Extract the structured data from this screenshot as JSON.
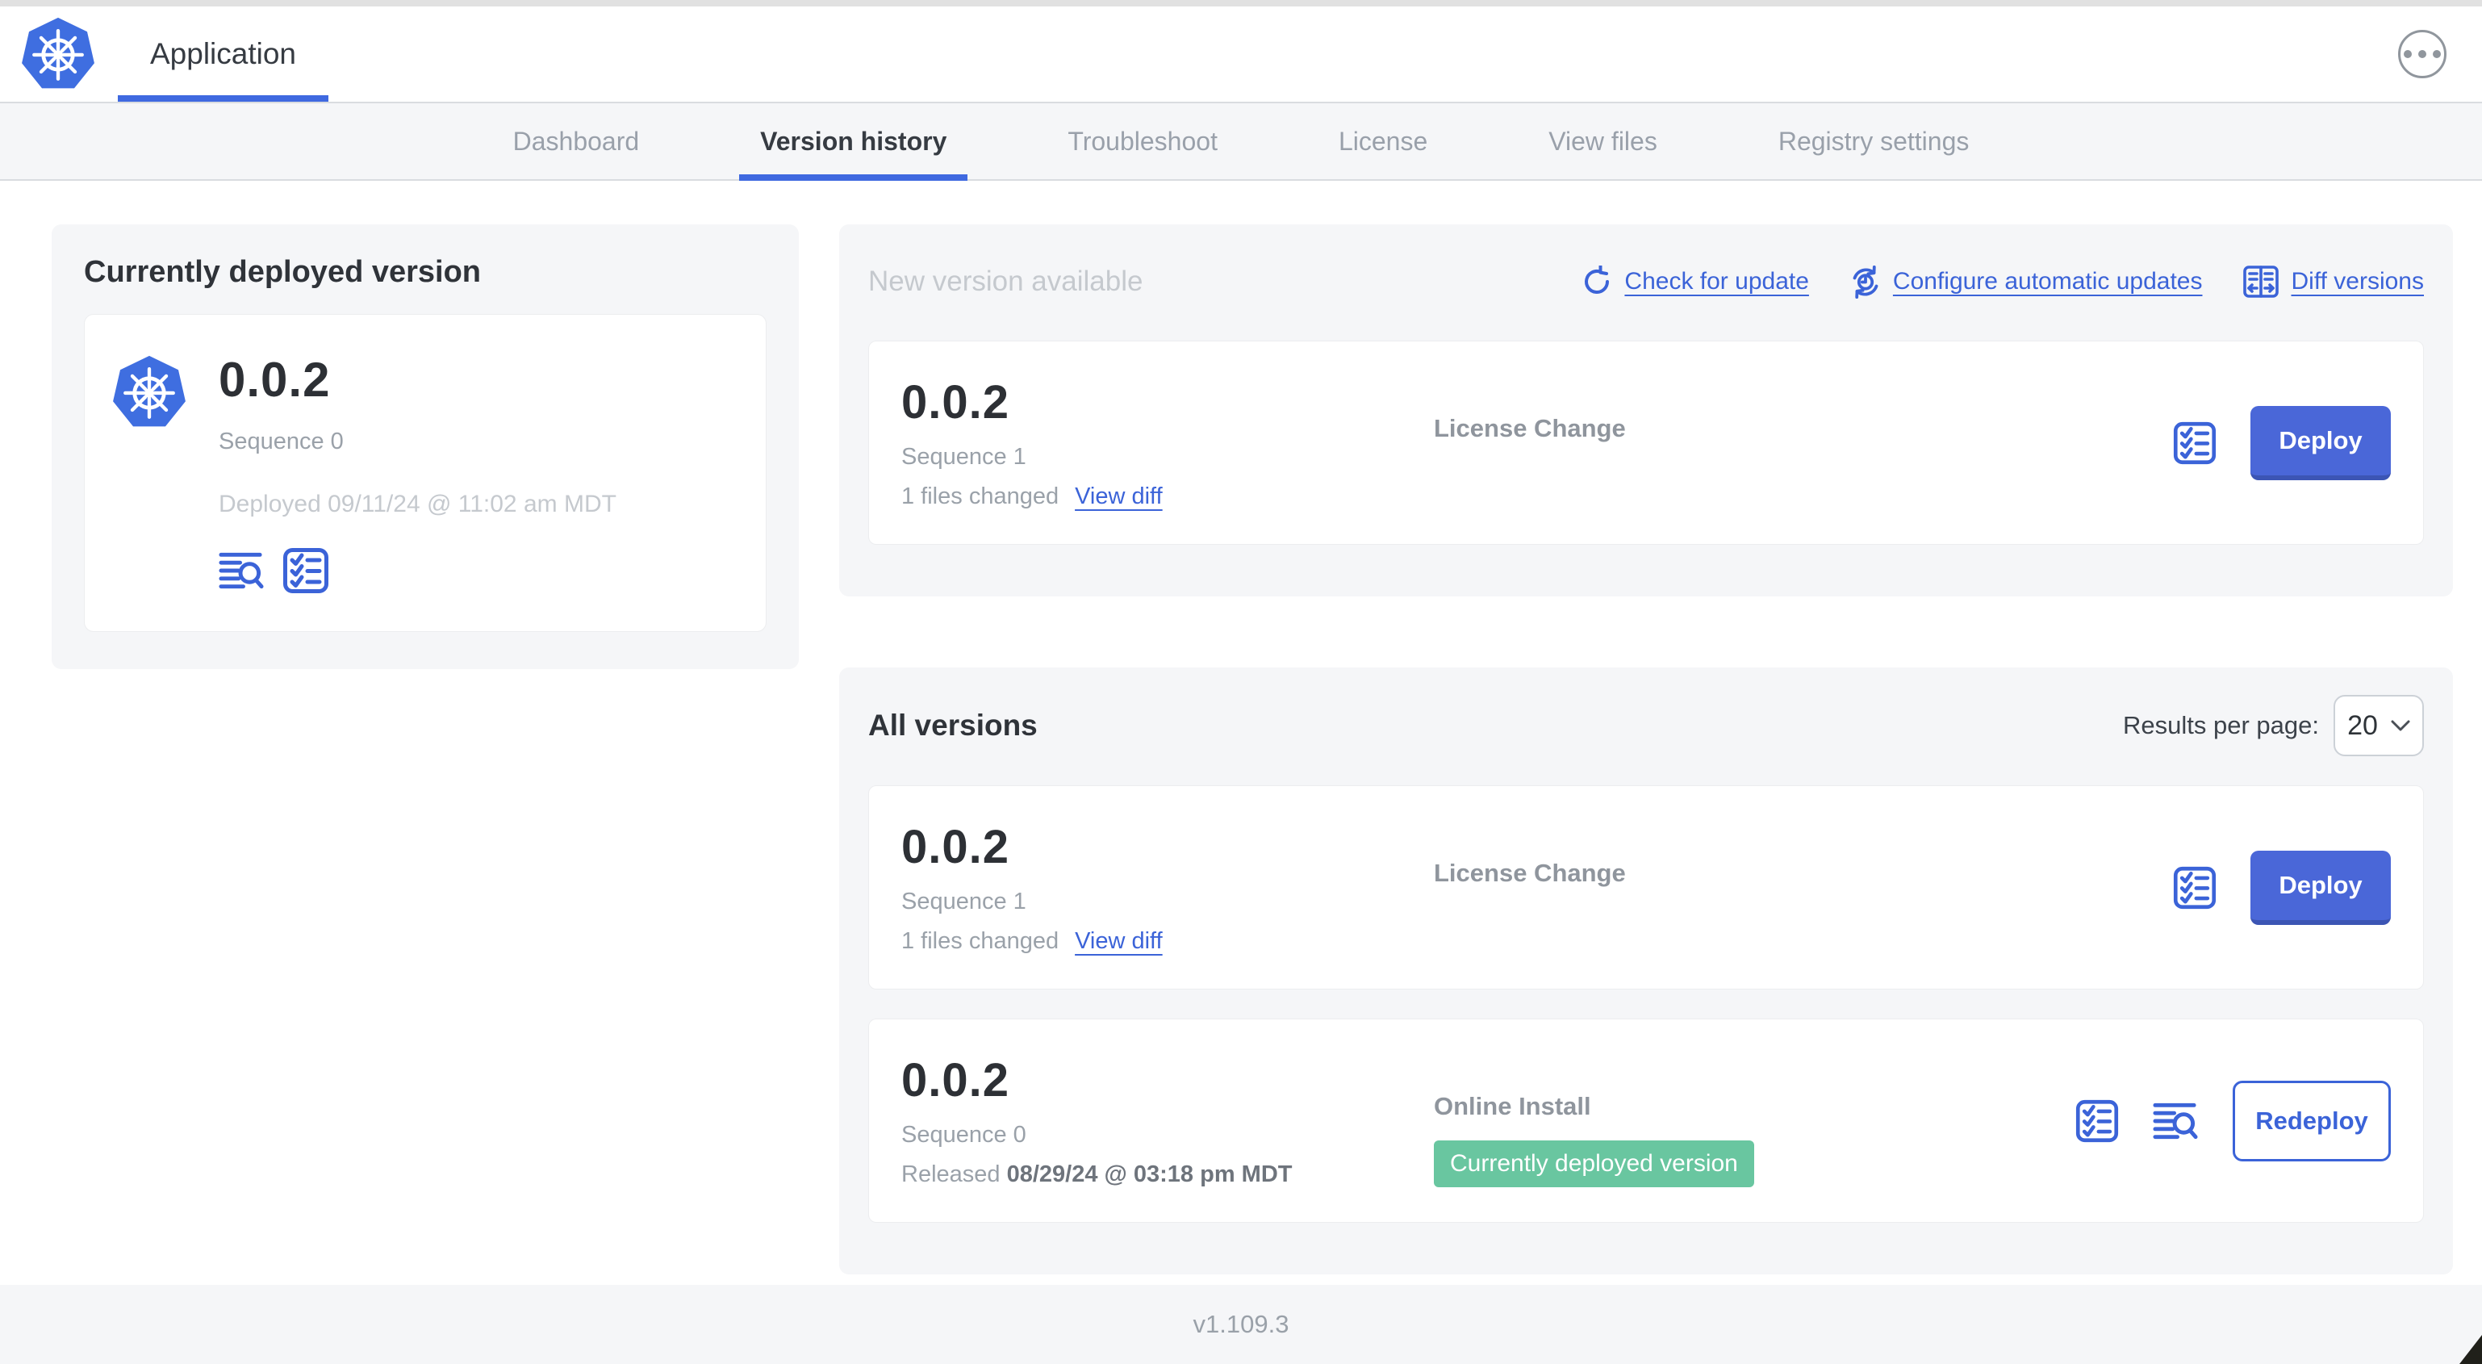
{
  "header": {
    "app_tab": "Application"
  },
  "nav": {
    "tabs": [
      {
        "label": "Dashboard"
      },
      {
        "label": "Version history"
      },
      {
        "label": "Troubleshoot"
      },
      {
        "label": "License"
      },
      {
        "label": "View files"
      },
      {
        "label": "Registry settings"
      }
    ]
  },
  "current": {
    "title": "Currently deployed version",
    "version": "0.0.2",
    "sequence": "Sequence 0",
    "deployed": "Deployed 09/11/24 @ 11:02 am MDT"
  },
  "new_version": {
    "title": "New version available",
    "check_link": "Check for update",
    "configure_link": "Configure automatic updates",
    "diff_link": "Diff versions",
    "row": {
      "version": "0.0.2",
      "sequence": "Sequence 1",
      "files_changed": "1 files changed",
      "view_diff": "View diff",
      "source": "License Change",
      "action": "Deploy"
    }
  },
  "all_versions": {
    "title": "All versions",
    "results_label": "Results per page:",
    "results_value": "20",
    "rows": [
      {
        "version": "0.0.2",
        "sequence": "Sequence 1",
        "files_changed": "1 files changed",
        "view_diff": "View diff",
        "source": "License Change",
        "action": "Deploy"
      },
      {
        "version": "0.0.2",
        "sequence": "Sequence 0",
        "released_label": "Released",
        "released_date": "08/29/24 @ 03:18 pm MDT",
        "source": "Online Install",
        "badge": "Currently deployed version",
        "action": "Redeploy"
      }
    ]
  },
  "footer": {
    "app_version": "v1.109.3"
  },
  "colors": {
    "accent_blue": "#3b63d8",
    "tab_underline_blue": "#3f69e0",
    "deploy_button_blue": "#4a67d8",
    "badge_green": "#69c6a0",
    "k8s_logo_blue": "#3f6ee0",
    "panel_gray": "#f5f6f8",
    "muted_text": "#9aa1a9",
    "faint_text": "#c5c9ce"
  }
}
